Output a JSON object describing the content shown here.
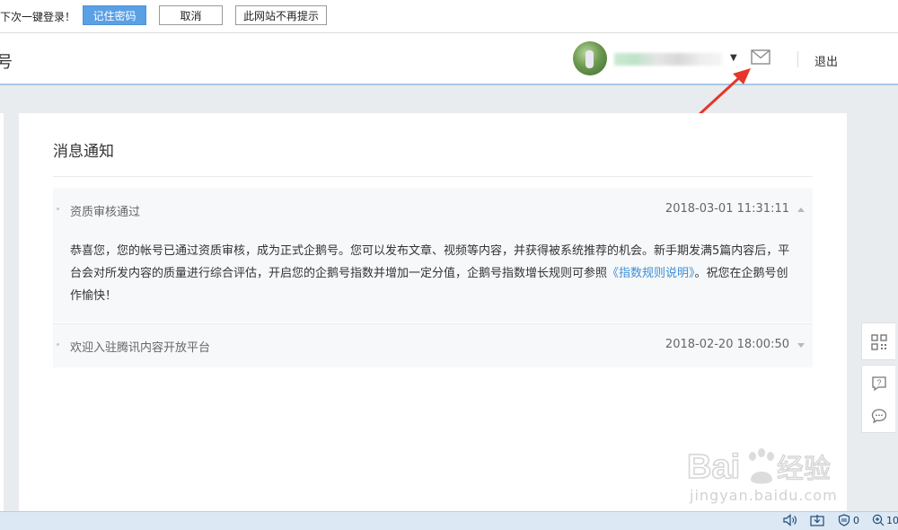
{
  "password_bar": {
    "message": "下次一键登录！",
    "save_label": "记住密码",
    "cancel_label": "取消",
    "never_label": "此网站不再提示"
  },
  "header": {
    "logo_fragment": "号",
    "username": "",
    "logout_label": "退出",
    "icons": [
      "avatar",
      "chevron-down-icon",
      "mail-icon"
    ]
  },
  "main": {
    "title": "消息通知",
    "messages": [
      {
        "title": "资质审核通过",
        "time": "2018-03-01 11:31:11",
        "expanded": true,
        "body_before": "恭喜您，您的帐号已通过资质审核，成为正式企鹅号。您可以发布文章、视频等内容，并获得被系统推荐的机会。新手期发满5篇内容后，平台会对所发内容的质量进行综合评估，开启您的企鹅号指数并增加一定分值，企鹅号指数增长规则可参照",
        "body_link": "《指数规则说明》",
        "body_after": "。祝您在企鹅号创作愉快！"
      },
      {
        "title": "欢迎入驻腾讯内容开放平台",
        "time": "2018-02-20 18:00:50",
        "expanded": false
      }
    ]
  },
  "side_tools": [
    "qr-code-icon",
    "help-icon",
    "feedback-icon"
  ],
  "statusbar": {
    "tray": [
      "volume-icon",
      "download-icon",
      "shield-icon"
    ],
    "shield_count": "0",
    "zoom_text": "10"
  },
  "watermark": {
    "url": "jingyan.baidu.com"
  },
  "colors": {
    "accent": "#5aa0e5",
    "link": "#3b8fd9",
    "arrow": "#e8352b"
  }
}
